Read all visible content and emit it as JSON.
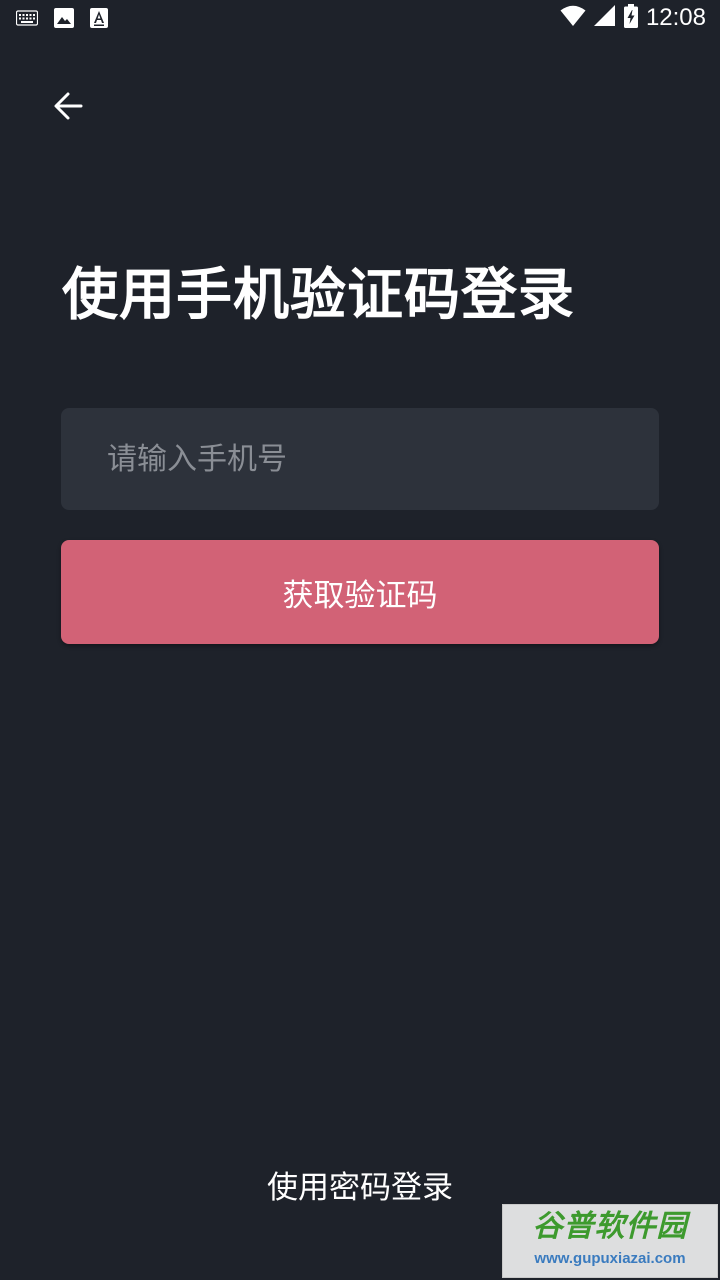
{
  "status_bar": {
    "time": "12:08",
    "icons": [
      "keyboard-icon",
      "image-icon",
      "font-a-icon",
      "wifi-icon",
      "signal-icon",
      "battery-charging-icon"
    ]
  },
  "header": {
    "back_icon": "arrow-left-icon"
  },
  "main": {
    "title": "使用手机验证码登录",
    "phone_input": {
      "placeholder": "请输入手机号",
      "value": ""
    },
    "get_code_label": "获取验证码"
  },
  "footer": {
    "password_login_label": "使用密码登录"
  },
  "watermark": {
    "name": "谷普软件园",
    "url": "www.gupuxiazai.com"
  },
  "colors": {
    "background": "#1e222a",
    "input_background": "#2d323b",
    "accent": "#d26276",
    "text": "#ffffff",
    "placeholder": "#8a8e95"
  }
}
